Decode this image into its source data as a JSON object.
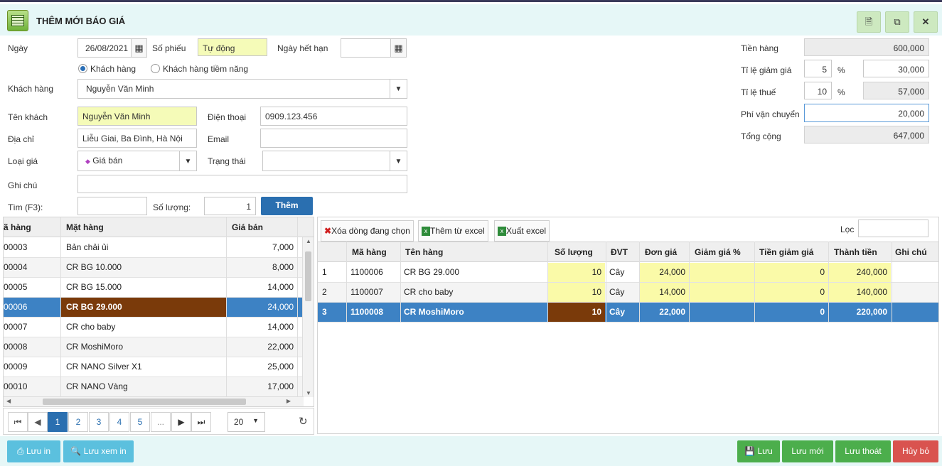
{
  "title": "THÊM MỚI BÁO GIÁ",
  "form": {
    "ngay_label": "Ngày",
    "ngay_value": "26/08/2021",
    "so_phieu_label": "Số phiếu",
    "so_phieu_value": "Tự động",
    "ngay_het_han_label": "Ngày hết hạn",
    "radio_khach_hang": "Khách hàng",
    "radio_tiem_nang": "Khách hàng tiềm năng",
    "khach_hang_label": "Khách hàng",
    "khach_hang_value": "Nguyễn Văn Minh",
    "ten_khach_label": "Tên khách",
    "ten_khach_value": "Nguyễn Văn Minh",
    "dien_thoai_label": "Điện thoại",
    "dien_thoai_value": "0909.123.456",
    "dia_chi_label": "Địa chỉ",
    "dia_chi_value": "Liễu Giai, Ba Đình, Hà Nội",
    "email_label": "Email",
    "loai_gia_label": "Loại giá",
    "loai_gia_value": "Giá bán",
    "trang_thai_label": "Trạng thái",
    "ghi_chu_label": "Ghi chú",
    "tim_label": "Tìm (F3):",
    "so_luong_label": "Số lượng:",
    "so_luong_value": "1",
    "them_button": "Thêm"
  },
  "summary": {
    "tien_hang_label": "Tiền hàng",
    "tien_hang_value": "600,000",
    "giam_gia_label": "Tỉ lệ giảm giá",
    "giam_gia_pct": "5",
    "giam_gia_value": "30,000",
    "thue_label": "Tỉ lệ thuế",
    "thue_pct": "10",
    "thue_value": "57,000",
    "pct_sign": "%",
    "phi_vc_label": "Phí vận chuyển",
    "phi_vc_value": "20,000",
    "tong_label": "Tổng cộng",
    "tong_value": "647,000"
  },
  "product_grid": {
    "headers": [
      "ã hàng",
      "Mặt hàng",
      "Giá bán"
    ],
    "rows": [
      {
        "code": "00003",
        "name": "Bản chải ủi",
        "price": "7,000"
      },
      {
        "code": "00004",
        "name": "CR BG 10.000",
        "price": "8,000"
      },
      {
        "code": "00005",
        "name": "CR BG 15.000",
        "price": "14,000"
      },
      {
        "code": "00006",
        "name": "CR BG 29.000",
        "price": "24,000"
      },
      {
        "code": "00007",
        "name": "CR cho baby",
        "price": "14,000"
      },
      {
        "code": "00008",
        "name": "CR MoshiMoro",
        "price": "22,000"
      },
      {
        "code": "00009",
        "name": "CR NANO Silver X1",
        "price": "25,000"
      },
      {
        "code": "00010",
        "name": "CR NANO Vàng",
        "price": "17,000"
      }
    ]
  },
  "pager": {
    "pages": [
      "1",
      "2",
      "3",
      "4",
      "5",
      "..."
    ],
    "page_size": "20"
  },
  "toolbar": {
    "xoa_dong": "Xóa dòng đang chọn",
    "them_excel": "Thêm từ excel",
    "xuat_excel": "Xuất excel",
    "loc_label": "Lọc"
  },
  "detail_grid": {
    "headers": [
      "Mã hàng",
      "Tên hàng",
      "Số lượng",
      "ĐVT",
      "Đơn giá",
      "Giảm giá %",
      "Tiền giảm giá",
      "Thành tiền",
      "Ghi chú"
    ],
    "rows": [
      {
        "stt": "1",
        "code": "1100006",
        "name": "CR BG 29.000",
        "qty": "10",
        "unit": "Cây",
        "price": "24,000",
        "disc_pct": "",
        "disc_amt": "0",
        "total": "240,000",
        "note": ""
      },
      {
        "stt": "2",
        "code": "1100007",
        "name": "CR cho baby",
        "qty": "10",
        "unit": "Cây",
        "price": "14,000",
        "disc_pct": "",
        "disc_amt": "0",
        "total": "140,000",
        "note": ""
      },
      {
        "stt": "3",
        "code": "1100008",
        "name": "CR MoshiMoro",
        "qty": "10",
        "unit": "Cây",
        "price": "22,000",
        "disc_pct": "",
        "disc_amt": "0",
        "total": "220,000",
        "note": ""
      }
    ]
  },
  "footer": {
    "luu_in": "Lưu in",
    "luu_xem_in": "Lưu xem in",
    "luu": "Lưu",
    "luu_moi": "Lưu mới",
    "luu_thoat": "Lưu thoát",
    "huy_bo": "Hủy bỏ"
  },
  "colors": {
    "accent_blue": "#2a6fb0",
    "selected_row": "#3d82c4",
    "highlight_brown": "#7a3a0a",
    "save_green": "#4cae4c",
    "cancel_red": "#d9534f"
  }
}
